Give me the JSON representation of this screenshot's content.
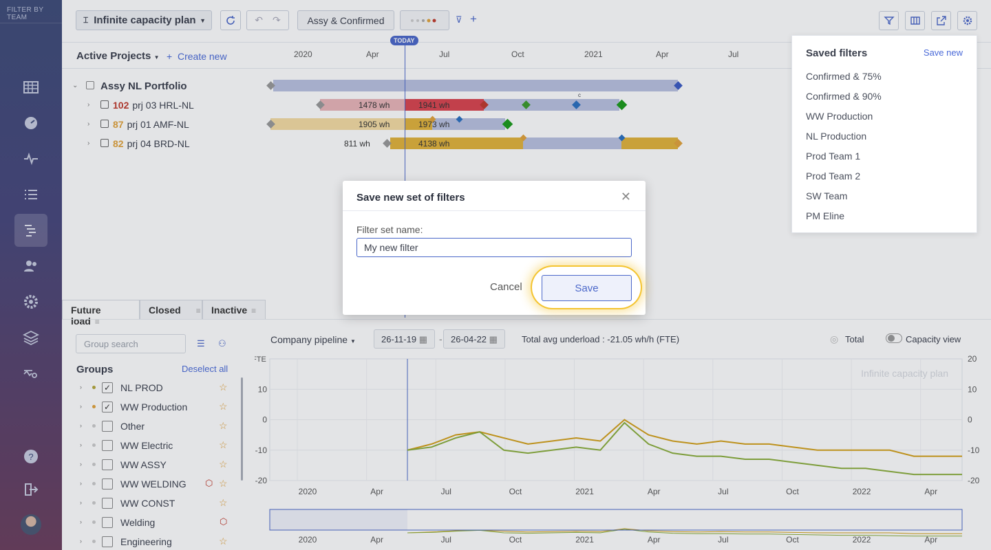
{
  "sidebar": {
    "brand": "FILTER BY TEAM",
    "items": [
      "grid-icon",
      "dashboard-icon",
      "pulse-icon",
      "list-icon",
      "gantt-icon",
      "people-icon",
      "gear-icon",
      "layers-icon",
      "search-chart-icon"
    ],
    "bottom": [
      "help-icon",
      "logout-icon"
    ]
  },
  "toolbar": {
    "plan": "Infinite capacity plan",
    "filter_tag": "Assy & Confirmed",
    "add": "+"
  },
  "timeline": {
    "active_projects": "Active Projects",
    "create_new": "Create new",
    "today": "TODAY",
    "labels": [
      "2020",
      "Apr",
      "Jul",
      "Oct",
      "2021",
      "Apr",
      "Jul"
    ]
  },
  "projects": [
    {
      "name": "Assy NL Portfolio",
      "num": "",
      "wh1": "",
      "wh2": ""
    },
    {
      "name": "prj 03 HRL-NL",
      "num": "102",
      "wh1": "1478 wh",
      "wh2": "1941 wh"
    },
    {
      "name": "prj 01 AMF-NL",
      "num": "87",
      "wh1": "1905 wh",
      "wh2": "1973 wh"
    },
    {
      "name": "prj 04 BRD-NL",
      "num": "82",
      "wh1": "811 wh",
      "wh2": "4138 wh"
    }
  ],
  "milestone_label": "c",
  "tabs": [
    {
      "label": "Future load"
    },
    {
      "label": "Closed"
    },
    {
      "label": "Inactive"
    }
  ],
  "groups_panel": {
    "search_placeholder": "Group search",
    "title": "Groups",
    "deselect": "Deselect all",
    "items": [
      {
        "name": "NL PROD",
        "checked": "✓",
        "dot": "#b5a73a"
      },
      {
        "name": "WW Production",
        "checked": "✓",
        "dot": "#e2a23a"
      },
      {
        "name": "Other",
        "checked": "",
        "dot": "#ccc"
      },
      {
        "name": "WW Electric",
        "checked": "",
        "dot": "#ccc"
      },
      {
        "name": "WW ASSY",
        "checked": "",
        "dot": "#ccc"
      },
      {
        "name": "WW WELDING",
        "checked": "",
        "dot": "#ccc"
      },
      {
        "name": "WW CONST",
        "checked": "",
        "dot": "#ccc"
      },
      {
        "name": "Welding",
        "checked": "",
        "dot": "#ccc"
      },
      {
        "name": "Engineering",
        "checked": "",
        "dot": "#ccc"
      }
    ]
  },
  "chart_controls": {
    "pipeline": "Company pipeline",
    "date_from": "26-11-19",
    "date_to": "26-04-22",
    "underload": "Total avg underload : -21.05 wh/h (FTE)",
    "total": "Total",
    "capacity_view": "Capacity view"
  },
  "chart_data": {
    "type": "line",
    "title": "",
    "watermark": "Infinite capacity plan",
    "ylabel": "FTE",
    "ylim": [
      -20,
      20
    ],
    "yticks_left": [
      "10",
      "0",
      "-10",
      "-20"
    ],
    "yticks_right": [
      "20",
      "10",
      "0",
      "-10",
      "-20"
    ],
    "xticks": [
      "2020",
      "Apr",
      "Jul",
      "Oct",
      "2021",
      "Apr",
      "Jul",
      "Oct",
      "2022",
      "Apr"
    ],
    "series": [
      {
        "color": "#d4a017",
        "values": [
          -10,
          -8,
          -5,
          -4,
          -6,
          -8,
          -7,
          -6,
          -7,
          0,
          -5,
          -7,
          -8,
          -7,
          -8,
          -8,
          -9,
          -10,
          -10,
          -10,
          -10,
          -12,
          -12,
          -12
        ]
      },
      {
        "color": "#8aae3a",
        "values": [
          -10,
          -9,
          -6,
          -4,
          -10,
          -11,
          -10,
          -9,
          -10,
          -1,
          -8,
          -11,
          -12,
          -12,
          -13,
          -13,
          -14,
          -15,
          -16,
          -16,
          -17,
          -18,
          -18,
          -18
        ]
      }
    ]
  },
  "saved_filters": {
    "title": "Saved filters",
    "save_new": "Save new",
    "items": [
      "Confirmed & 75%",
      "Confirmed & 90%",
      "WW Production",
      "NL Production",
      "Prod Team 1",
      "Prod Team 2",
      "SW Team",
      "PM Eline"
    ]
  },
  "modal": {
    "title": "Save new set of filters",
    "label": "Filter set name:",
    "value": "My new filter",
    "cancel": "Cancel",
    "save": "Save"
  }
}
